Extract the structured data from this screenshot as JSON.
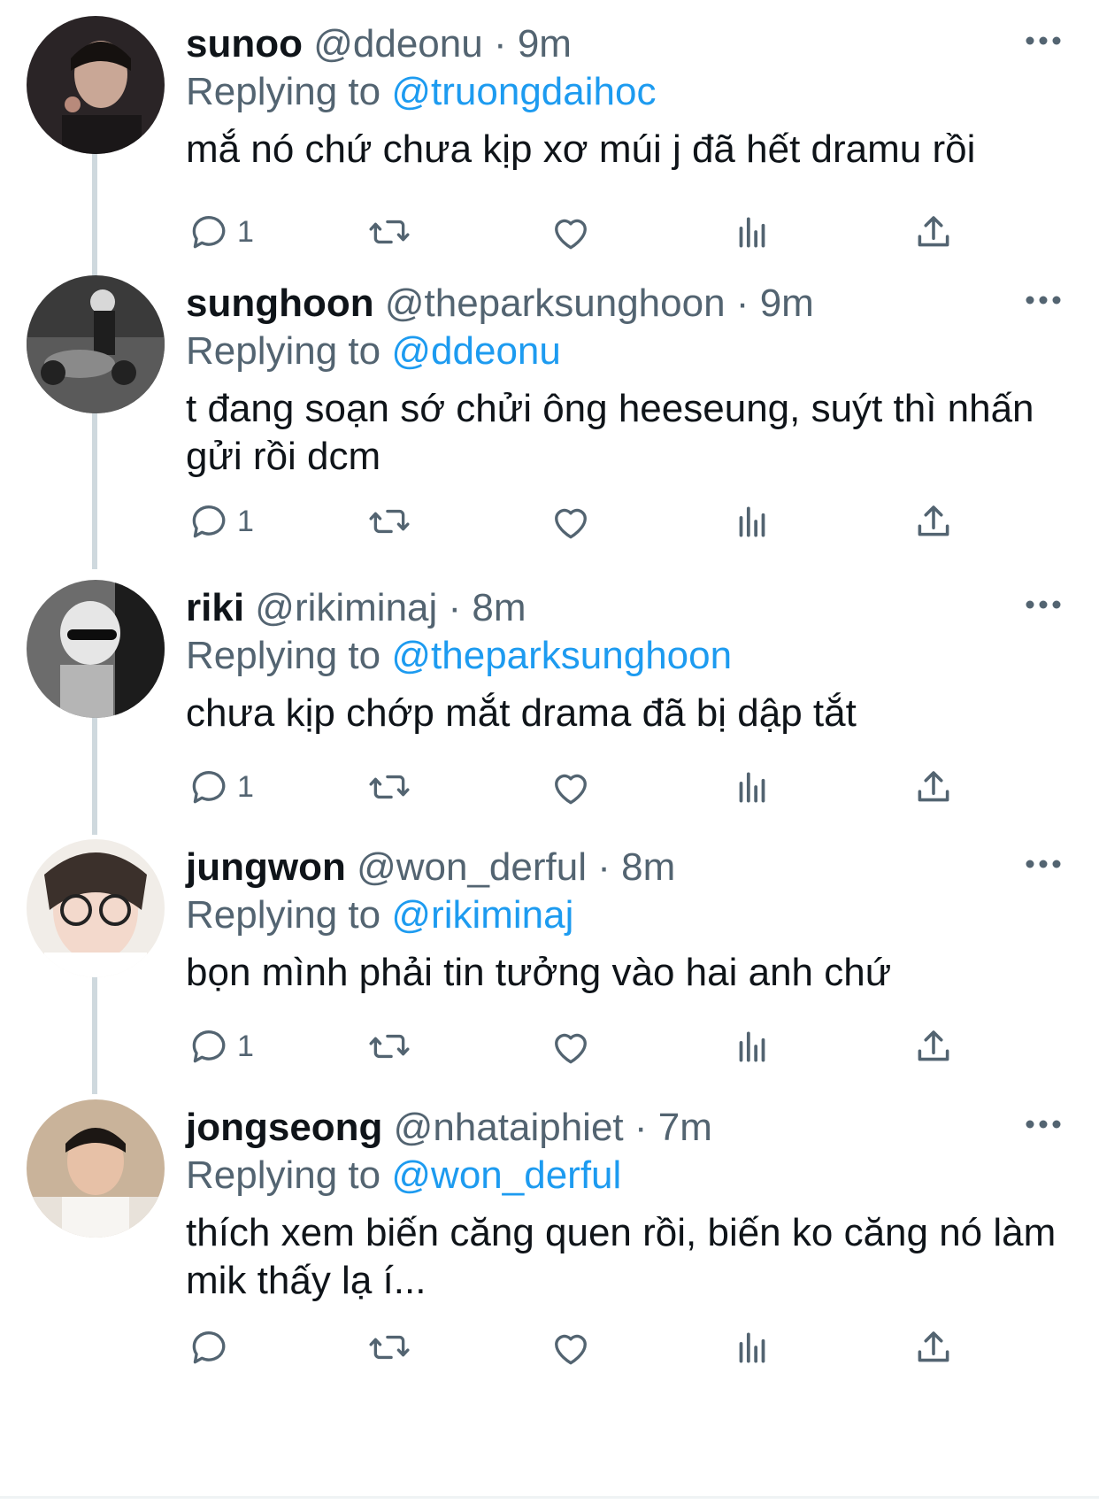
{
  "theme": {
    "text_primary": "#0f1419",
    "text_secondary": "#536471",
    "link": "#1d9bf0",
    "thread_line": "#cfd9de"
  },
  "replying_prefix": "Replying to",
  "tweets": [
    {
      "display_name": "sunoo",
      "handle": "@ddeonu",
      "time": "9m",
      "replying_to": "@truongdaihoc",
      "text": "mắ nó chứ chưa kịp xơ múi j đã hết dramu rồi",
      "reply_count": "1",
      "avatar": "avatar-photo"
    },
    {
      "display_name": "sunghoon",
      "handle": "@theparksunghoon",
      "time": "9m",
      "replying_to": "@ddeonu",
      "text": "t đang soạn sớ chửi ông heeseung, suýt thì nhấn gửi rồi dcm",
      "reply_count": "1",
      "avatar": "avatar-photo"
    },
    {
      "display_name": "riki",
      "handle": "@rikiminaj",
      "time": "8m",
      "replying_to": "@theparksunghoon",
      "text": "chưa kịp chớp mắt drama đã bị dập tắt",
      "reply_count": "1",
      "avatar": "avatar-photo"
    },
    {
      "display_name": "jungwon",
      "handle": "@won_derful",
      "time": "8m",
      "replying_to": "@rikiminaj",
      "text": "bọn mình phải tin tưởng vào hai anh chứ",
      "reply_count": "1",
      "avatar": "avatar-photo"
    },
    {
      "display_name": "jongseong",
      "handle": "@nhataiphiet",
      "time": "7m",
      "replying_to": "@won_derful",
      "text": "thích xem biến căng quen rồi, biến ko căng nó làm mik thấy lạ í...",
      "reply_count": "",
      "avatar": "avatar-photo"
    }
  ],
  "icons": [
    "more-icon",
    "reply-icon",
    "retweet-icon",
    "like-icon",
    "views-icon",
    "share-icon"
  ]
}
